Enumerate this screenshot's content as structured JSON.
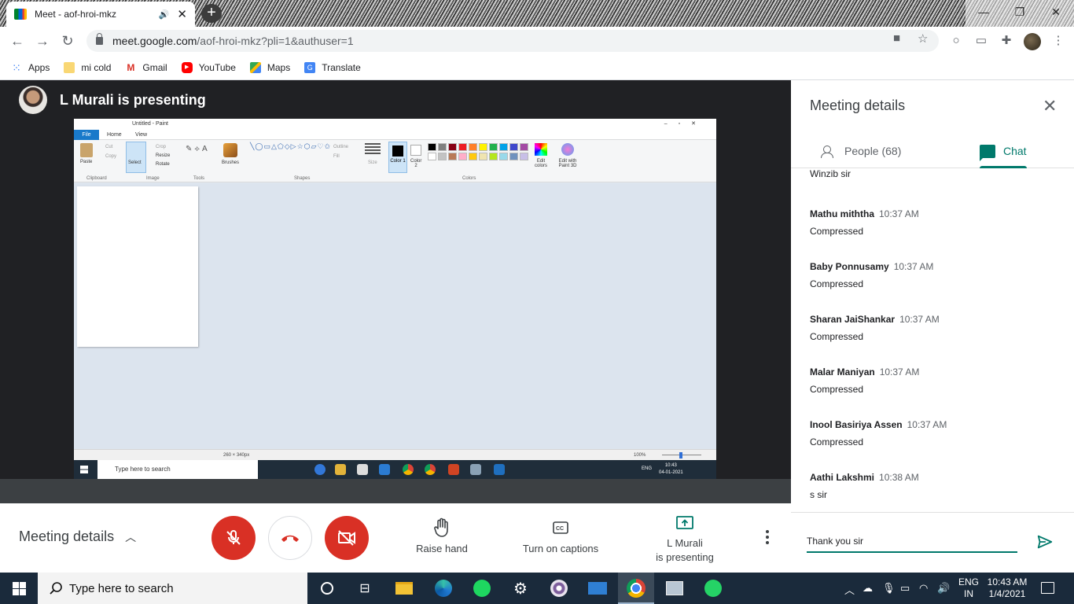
{
  "browser": {
    "tab_title": "Meet - aof-hroi-mkz",
    "url_host": "meet.google.com",
    "url_path": "/aof-hroi-mkz?pli=1&authuser=1",
    "bookmarks": [
      {
        "label": "Apps",
        "icon": "apps-grid-icon"
      },
      {
        "label": "mi cold",
        "icon": "folder-icon"
      },
      {
        "label": "Gmail",
        "icon": "gmail-icon"
      },
      {
        "label": "YouTube",
        "icon": "youtube-icon"
      },
      {
        "label": "Maps",
        "icon": "maps-icon"
      },
      {
        "label": "Translate",
        "icon": "translate-icon"
      }
    ]
  },
  "meeting": {
    "presenter_text": "L Murali is presenting",
    "shared_screen": {
      "window_title": "Untitled - Paint",
      "menu": [
        "File",
        "Home",
        "View"
      ],
      "ribbon_groups": [
        "Clipboard",
        "Image",
        "Tools",
        "Shapes",
        "Colors"
      ],
      "ribbon_buttons": [
        "Paste",
        "Cut",
        "Copy",
        "Select",
        "Crop",
        "Resize",
        "Rotate",
        "Brushes",
        "Outline",
        "Fill",
        "Size",
        "Color 1",
        "Color 2",
        "Edit colors",
        "Edit with Paint 3D"
      ],
      "palette_colors": [
        "#000000",
        "#7f7f7f",
        "#880015",
        "#ed1c24",
        "#ff7f27",
        "#fff200",
        "#22b14c",
        "#00a2e8",
        "#3f48cc",
        "#a349a4",
        "#ffffff",
        "#c3c3c3",
        "#b97a57",
        "#ffaec9",
        "#ffc90e",
        "#efe4b0",
        "#b5e61d",
        "#99d9ea",
        "#7092be",
        "#c8bfe7"
      ],
      "status_size": "260 × 340px",
      "zoom": "100%",
      "remote_search": "Type here to search",
      "remote_lang": "ENG",
      "remote_time": "10:43",
      "remote_date": "04-01-2021"
    }
  },
  "panel": {
    "title": "Meeting details",
    "tab_people": "People (68)",
    "tab_chat": "Chat",
    "messages": [
      {
        "sender": "",
        "time": "",
        "text": "Winzib sir"
      },
      {
        "sender": "Mathu miththa",
        "time": "10:37 AM",
        "text": "Compressed"
      },
      {
        "sender": "Baby Ponnusamy",
        "time": "10:37 AM",
        "text": "Compressed"
      },
      {
        "sender": "Sharan JaiShankar",
        "time": "10:37 AM",
        "text": "Compressed"
      },
      {
        "sender": "Malar Maniyan",
        "time": "10:37 AM",
        "text": "Compressed"
      },
      {
        "sender": "Inool Basiriya Assen",
        "time": "10:37 AM",
        "text": "Compressed"
      },
      {
        "sender": "Aathi Lakshmi",
        "time": "10:38 AM",
        "text": "s sir"
      }
    ],
    "input_value": "Thank you sir"
  },
  "controls": {
    "meeting_details": "Meeting details",
    "raise_hand": "Raise hand",
    "captions": "Turn on captions",
    "presenting_line1": "L Murali",
    "presenting_line2": "is presenting"
  },
  "taskbar": {
    "search_placeholder": "Type here to search",
    "lang_line1": "ENG",
    "lang_line2": "IN",
    "time": "10:43 AM",
    "date": "1/4/2021"
  },
  "colors": {
    "meet_red": "#d93025",
    "meet_teal": "#00796b",
    "stage_bg": "#202124"
  }
}
